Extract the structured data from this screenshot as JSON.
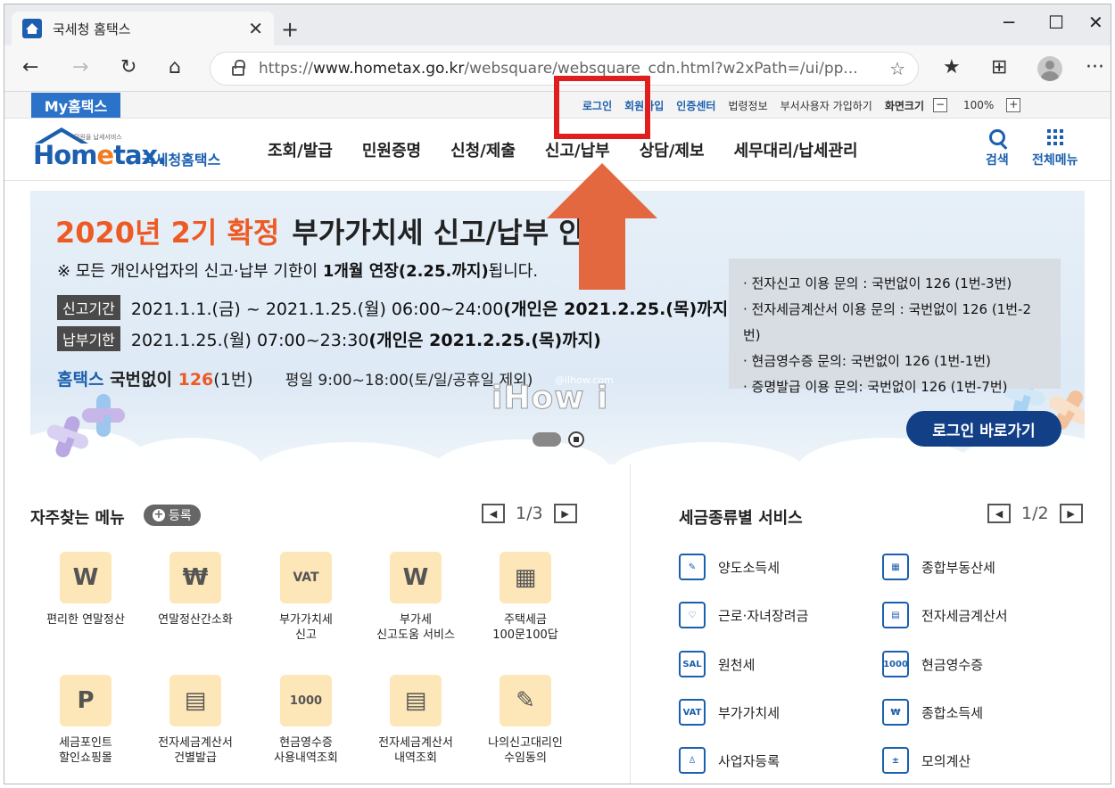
{
  "browser": {
    "tab_title": "국세청 홈택스",
    "tab_close": "✕",
    "new_tab": "+",
    "url_scheme": "https://",
    "url_host": "www.hometax.go.kr",
    "url_path": "/websquare/websquare_cdn.html?w2xPath=/ui/pp...",
    "controls": {
      "minimize": "─",
      "maximize": "☐",
      "close": "✕",
      "more": "···"
    },
    "icons": {
      "back": "←",
      "forward": "→",
      "refresh": "↻",
      "home": "⌂",
      "star": "☆",
      "favorites": "★",
      "collections": "⊞"
    }
  },
  "utility": {
    "my_hometax": "My홈택스",
    "links": [
      "로그인",
      "회원가입",
      "인증센터"
    ],
    "gray_links": [
      "법령정보",
      "부서사용자 가입하기"
    ],
    "screen_size": "화면크기",
    "zoom": "100%",
    "zoom_minus": "−",
    "zoom_plus": "+"
  },
  "header": {
    "logo_word_pre": "Hom",
    "logo_word_e": "e",
    "logo_word_post": "tax.",
    "logo_tagline": "민원을 납세서비스",
    "logo_ko": "국세청홈택스",
    "nav": [
      "조회/발급",
      "민원증명",
      "신청/제출",
      "신고/납부",
      "상담/제보",
      "세무대리/납세관리"
    ],
    "search_label": "검색",
    "menu_label": "전체메뉴"
  },
  "banner": {
    "title_orange": "2020년 2기 확정",
    "title_dark": "부가가치세 신고/납부 안내",
    "notice_pre": "※ 모든 개인사업자의 신고·납부 기한이 ",
    "notice_bold": "1개월 연장(2.25.까지)",
    "notice_post": "됩니다.",
    "filing_chip": "신고기간",
    "filing_text": "2021.1.1.(금) ~ 2021.1.25.(월) 06:00~24:00 ",
    "filing_bold": "(개인은 2021.2.25.(목)까지)",
    "payment_chip": "납부기한",
    "payment_text": "2021.1.25.(월) 07:00~23:30 ",
    "payment_bold": "(개인은 2021.2.25.(목)까지)",
    "phone_brand": "홈택스",
    "phone_pre": " 국번없이 ",
    "phone_num": "126",
    "phone_post": "(1번)",
    "hours": "평일 9:00~18:00(토/일/공휴일 제외)",
    "info_lines": [
      "· 전자신고 이용 문의 : 국번없이 126 (1번-3번)",
      "· 전자세금계산서 이용 문의 : 국번없이 126 (1번-2번)",
      "· 현금영수증 문의: 국번없이 126 (1번-1번)",
      "· 증명발급 이용 문의: 국번없이 126 (1번-7번)"
    ],
    "login_button": "로그인 바로가기",
    "watermark": "iHow i",
    "watermark_site": "@ilhow.com"
  },
  "favorites": {
    "title": "자주찾는 메뉴",
    "register": "등록",
    "register_icon": "+",
    "page": "1/3",
    "items": [
      {
        "label": "편리한 연말정산",
        "icon": "W"
      },
      {
        "label": "연말정산간소화",
        "icon": "₩"
      },
      {
        "label": "부가가치세\n신고",
        "icon": "VAT"
      },
      {
        "label": "부가세\n신고도움 서비스",
        "icon": "W"
      },
      {
        "label": "주택세금\n100문100답",
        "icon": "▦"
      },
      {
        "label": "세금포인트\n할인쇼핑몰",
        "icon": "P"
      },
      {
        "label": "전자세금계산서\n건별발급",
        "icon": "▤"
      },
      {
        "label": "현금영수증\n사용내역조회",
        "icon": "1000"
      },
      {
        "label": "전자세금계산서\n내역조회",
        "icon": "▤"
      },
      {
        "label": "나의신고대리인\n수임동의",
        "icon": "✎"
      }
    ]
  },
  "tax_services": {
    "title": "세금종류별 서비스",
    "page": "1/2",
    "items": [
      {
        "label": "양도소득세",
        "icon": "✎"
      },
      {
        "label": "종합부동산세",
        "icon": "▦"
      },
      {
        "label": "근로·자녀장려금",
        "icon": "♡"
      },
      {
        "label": "전자세금계산서",
        "icon": "▤"
      },
      {
        "label": "원천세",
        "icon": "SAL"
      },
      {
        "label": "현금영수증",
        "icon": "1000"
      },
      {
        "label": "부가가치세",
        "icon": "VAT"
      },
      {
        "label": "종합소득세",
        "icon": "₩"
      },
      {
        "label": "사업자등록",
        "icon": "♙"
      },
      {
        "label": "모의계산",
        "icon": "±"
      }
    ]
  },
  "pager_icons": {
    "prev": "◀",
    "next": "▶"
  },
  "colors": {
    "brand": "#1b5fae",
    "accent": "#ee5a24",
    "annotation": "#e01e1e",
    "arrow": "#e4683f"
  }
}
